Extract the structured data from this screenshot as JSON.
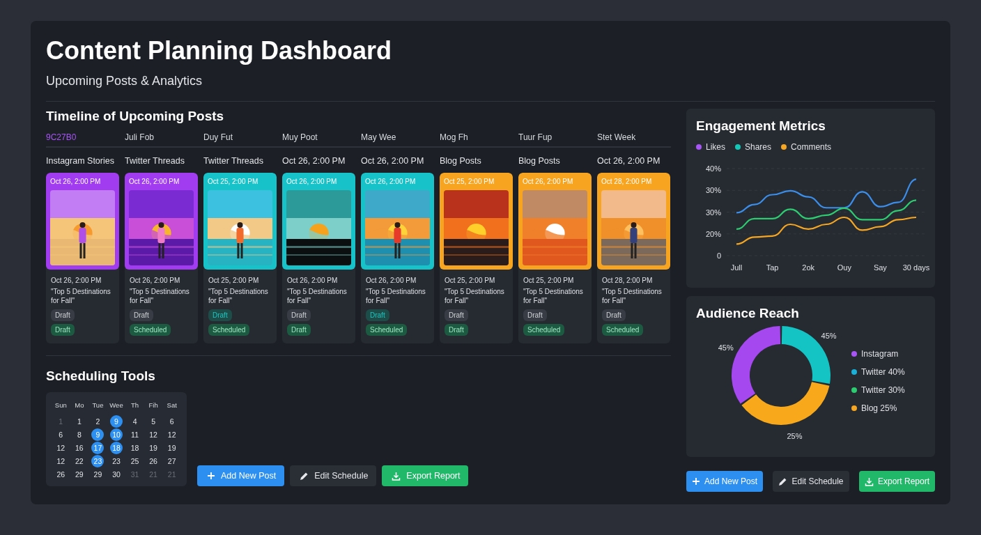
{
  "header": {
    "title": "Content Planning Dashboard",
    "subtitle": "Upcoming Posts & Analytics"
  },
  "timeline": {
    "title": "Timeline of Upcoming Posts",
    "tabs": [
      {
        "label": "9C27B0",
        "selected": true
      },
      {
        "label": "Juli Fob",
        "selected": false
      },
      {
        "label": "Duy Fut",
        "selected": false
      },
      {
        "label": "Muy Poot",
        "selected": false
      },
      {
        "label": "May Wee",
        "selected": false
      },
      {
        "label": "Mog Fh",
        "selected": false
      },
      {
        "label": "Tuur Fup",
        "selected": false
      },
      {
        "label": "Stet Week",
        "selected": false
      }
    ],
    "channels": [
      "Instagram Stories",
      "Twitter Threads",
      "Twitter Threads",
      "Oct 26, 2:00 PM",
      "Oct 26, 2:00 PM",
      "Blog Posts",
      "Blog Posts",
      "Oct 26, 2:00 PM"
    ],
    "posts": [
      {
        "color": "#a23cf0",
        "top_date": "Oct 26, 2:00 PM",
        "date": "Oct 26, 2:00 PM",
        "title": "\"Top 5 Destinations for Fall\"",
        "badges": [
          {
            "label": "Draft",
            "kind": "neutral"
          },
          {
            "label": "Draft",
            "kind": "success"
          }
        ]
      },
      {
        "color": "#a23cf0",
        "top_date": "Oct 26, 2:00 PM",
        "date": "Oct 26, 2:00 PM",
        "title": "\"Top 5 Destinations for Fall\"",
        "badges": [
          {
            "label": "Draft",
            "kind": "neutral"
          },
          {
            "label": "Scheduled",
            "kind": "success"
          }
        ]
      },
      {
        "color": "#17c3c8",
        "top_date": "Oct 25, 2:00 PM",
        "date": "Oct 25, 2:00 PM",
        "title": "\"Top 5 Destinations for Fall\"",
        "badges": [
          {
            "label": "Draft",
            "kind": "info"
          },
          {
            "label": "Scheduled",
            "kind": "success"
          }
        ]
      },
      {
        "color": "#17c3c8",
        "top_date": "Oct 26, 2:00 PM",
        "date": "Oct 26, 2:00 PM",
        "title": "\"Top 5 Destinations for Fall\"",
        "badges": [
          {
            "label": "Draft",
            "kind": "neutral"
          },
          {
            "label": "Draft",
            "kind": "success"
          }
        ]
      },
      {
        "color": "#17c3c8",
        "top_date": "Oct 26, 2:00 PM",
        "date": "Oct 26, 2:00 PM",
        "title": "\"Top 5 Destinations for Fall\"",
        "badges": [
          {
            "label": "Draft",
            "kind": "info"
          },
          {
            "label": "Scheduled",
            "kind": "success"
          }
        ]
      },
      {
        "color": "#f7a520",
        "top_date": "Oct 25, 2:00 PM",
        "date": "Oct 25, 2:00 PM",
        "title": "\"Top 5 Destinations for Fall\"",
        "badges": [
          {
            "label": "Draft",
            "kind": "neutral"
          },
          {
            "label": "Draft",
            "kind": "success"
          }
        ]
      },
      {
        "color": "#f7a520",
        "top_date": "Oct 26, 2:00 PM",
        "date": "Oct 25, 2:00 PM",
        "title": "\"Top 5 Destinations for Fall\"",
        "badges": [
          {
            "label": "Draft",
            "kind": "neutral"
          },
          {
            "label": "Scheduled",
            "kind": "success"
          }
        ]
      },
      {
        "color": "#f7a520",
        "top_date": "Oct 28, 2:00 PM",
        "date": "Oct 28, 2:00 PM",
        "title": "\"Top 5 Destinations for Fall\"",
        "badges": [
          {
            "label": "Draft",
            "kind": "neutral"
          },
          {
            "label": "Scheduled",
            "kind": "success"
          }
        ]
      }
    ]
  },
  "scheduling": {
    "title": "Scheduling Tools",
    "calendar": {
      "weekdays": [
        "Sun",
        "Mo",
        "Tue",
        "Wee",
        "Th",
        "Fih",
        "Sat"
      ],
      "weeks": [
        [
          {
            "day": "1",
            "selected": false,
            "muted": true
          },
          {
            "day": "1",
            "selected": false,
            "muted": false
          },
          {
            "day": "2",
            "selected": false,
            "muted": false
          },
          {
            "day": "9",
            "selected": true,
            "muted": false
          },
          {
            "day": "4",
            "selected": false,
            "muted": false
          },
          {
            "day": "5",
            "selected": false,
            "muted": false
          },
          {
            "day": "6",
            "selected": false,
            "muted": false
          }
        ],
        [
          {
            "day": "6",
            "selected": false,
            "muted": false
          },
          {
            "day": "8",
            "selected": false,
            "muted": false
          },
          {
            "day": "9",
            "selected": true,
            "muted": false
          },
          {
            "day": "10",
            "selected": true,
            "muted": false
          },
          {
            "day": "11",
            "selected": false,
            "muted": false
          },
          {
            "day": "12",
            "selected": false,
            "muted": false
          },
          {
            "day": "12",
            "selected": false,
            "muted": false
          }
        ],
        [
          {
            "day": "12",
            "selected": false,
            "muted": false
          },
          {
            "day": "16",
            "selected": false,
            "muted": false
          },
          {
            "day": "17",
            "selected": true,
            "muted": false
          },
          {
            "day": "18",
            "selected": true,
            "muted": false
          },
          {
            "day": "18",
            "selected": false,
            "muted": false
          },
          {
            "day": "19",
            "selected": false,
            "muted": false
          },
          {
            "day": "19",
            "selected": false,
            "muted": false
          }
        ],
        [
          {
            "day": "12",
            "selected": false,
            "muted": false
          },
          {
            "day": "22",
            "selected": false,
            "muted": false
          },
          {
            "day": "23",
            "selected": true,
            "muted": false
          },
          {
            "day": "23",
            "selected": false,
            "muted": false
          },
          {
            "day": "25",
            "selected": false,
            "muted": false
          },
          {
            "day": "26",
            "selected": false,
            "muted": false
          },
          {
            "day": "27",
            "selected": false,
            "muted": false
          }
        ],
        [
          {
            "day": "26",
            "selected": false,
            "muted": false
          },
          {
            "day": "29",
            "selected": false,
            "muted": false
          },
          {
            "day": "29",
            "selected": false,
            "muted": false
          },
          {
            "day": "30",
            "selected": false,
            "muted": false
          },
          {
            "day": "31",
            "selected": false,
            "muted": true
          },
          {
            "day": "21",
            "selected": false,
            "muted": true
          },
          {
            "day": "21",
            "selected": false,
            "muted": true
          }
        ]
      ]
    },
    "buttons": [
      {
        "label": "Add New Post",
        "kind": "add"
      },
      {
        "label": "Edit Schedule",
        "kind": "edit"
      },
      {
        "label": "Export Report",
        "kind": "export"
      }
    ]
  },
  "engagement": {
    "title": "Engagement Metrics",
    "legend": [
      {
        "label": "Likes",
        "color": "#a855f7"
      },
      {
        "label": "Shares",
        "color": "#14c8b8"
      },
      {
        "label": "Comments",
        "color": "#f5a623"
      }
    ],
    "chart_data": {
      "type": "line",
      "categories": [
        "Jull",
        null,
        "Tap",
        null,
        "2ok",
        null,
        "Ouy",
        null,
        "Say",
        null,
        "30 days"
      ],
      "ylim": [
        0,
        40
      ],
      "yticks": [
        {
          "value": 40,
          "label": "40%"
        },
        {
          "value": 30,
          "label": "30%"
        },
        {
          "value": 0,
          "label": "0"
        }
      ],
      "series": [
        {
          "color": "#3b8eea",
          "values": [
            19.7,
            23.5,
            28,
            29.8,
            27,
            22,
            22,
            29.3,
            22.5,
            24.5,
            35.1
          ]
        },
        {
          "color": "#2ecc71",
          "values": [
            12.2,
            17,
            17,
            21.3,
            17,
            18.6,
            21.8,
            16.5,
            16.5,
            20.7,
            25.5
          ]
        },
        {
          "color": "#f5a623",
          "values": [
            5.3,
            8.5,
            9,
            14.4,
            12.2,
            14.4,
            17.6,
            11.7,
            13.3,
            16.5,
            17.6
          ]
        }
      ]
    },
    "other_y_labels": [
      "30%",
      "20%"
    ]
  },
  "audience": {
    "title": "Audience Reach",
    "legend": [
      {
        "label": "Instagram",
        "color": "#a855f7"
      },
      {
        "label": "Twitter 40%",
        "color": "#1ab0d8"
      },
      {
        "label": "Twitter 30%",
        "color": "#2ecc71"
      },
      {
        "label": "Blog 25%",
        "color": "#f5a623"
      }
    ],
    "slice_labels": [
      "45%",
      "25%",
      "45%"
    ]
  },
  "right_buttons": [
    {
      "label": "Add New Post",
      "kind": "add"
    },
    {
      "label": "Edit Schedule",
      "kind": "edit"
    },
    {
      "label": "Export Report",
      "kind": "export"
    }
  ]
}
